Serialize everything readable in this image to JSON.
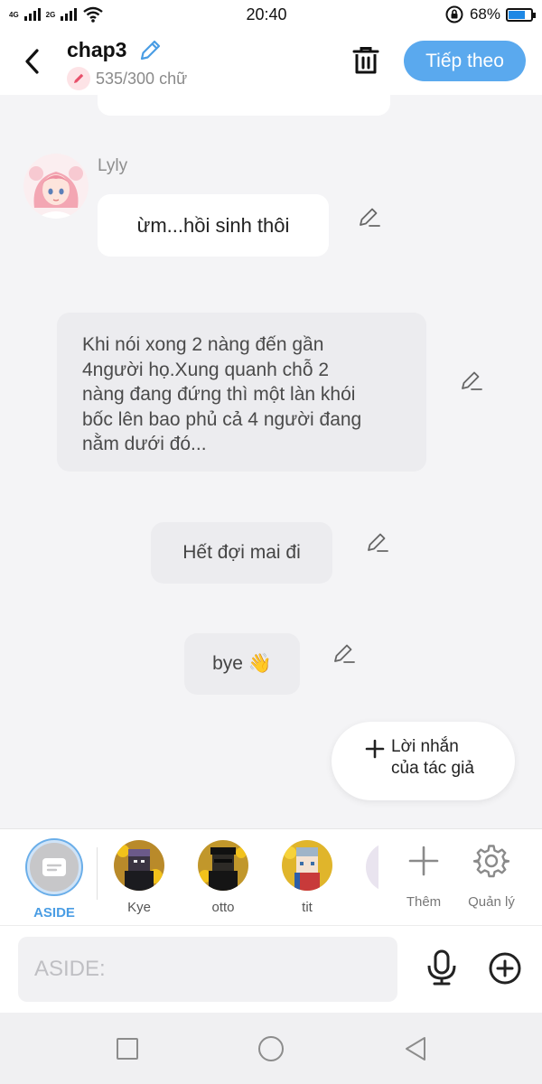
{
  "status_bar": {
    "network_top": "4G",
    "network_bottom": "2G",
    "time": "20:40",
    "battery_percent": "68%",
    "battery_level": 0.68,
    "icons": [
      "signal-icon",
      "signal-icon",
      "wifi-icon",
      "rotation-lock-icon",
      "battery-icon"
    ]
  },
  "header": {
    "title": "chap3",
    "word_count": "535/300 chữ",
    "next_button": "Tiếp theo",
    "icons": [
      "back-arrow-icon",
      "edit-pencil-icon",
      "trash-icon"
    ]
  },
  "messages": [
    {
      "type": "character",
      "sender": "Lyly",
      "text": "ừm...hồi sinh thôi"
    },
    {
      "type": "narration",
      "lines": [
        "Khi nói xong 2 nàng đến gần",
        "4người họ.Xung quanh chỗ 2",
        "nàng đang đứng thì một làn khói",
        "bốc lên bao phủ cả 4 người đang",
        "nằm dưới đó..."
      ]
    },
    {
      "type": "narration",
      "text": "Hết đợi mai đi"
    },
    {
      "type": "narration",
      "text": "bye 👋"
    }
  ],
  "author_note": {
    "line1": "Lời nhắn",
    "line2": "của tác giả"
  },
  "characters": [
    {
      "name": "ASIDE",
      "selected": true
    },
    {
      "name": "Kye"
    },
    {
      "name": "otto"
    },
    {
      "name": "tit"
    }
  ],
  "tools": {
    "add_label": "Thêm",
    "manage_label": "Quản lý"
  },
  "composer": {
    "placeholder": "ASIDE:"
  },
  "colors": {
    "accent": "#5aa9ee",
    "aside_label": "#4a9de4",
    "background": "#f4f4f6",
    "narration_bubble": "#ececef"
  }
}
